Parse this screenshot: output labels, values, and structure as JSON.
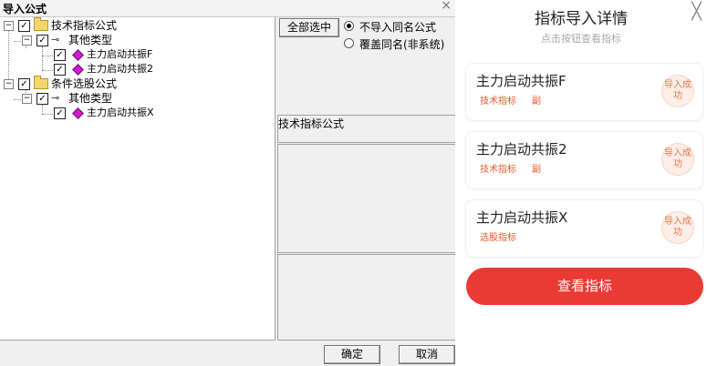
{
  "dialog": {
    "title": "导入公式",
    "tree": {
      "root1": "技术指标公式",
      "root1_child": "其他类型",
      "root1_items": [
        "主力启动共振F",
        "主力启动共振2"
      ],
      "root2": "条件选股公式",
      "root2_child": "其他类型",
      "root2_items": [
        "主力启动共振X"
      ]
    },
    "select_all": "全部选中",
    "options": [
      "不导入同名公式",
      "覆盖同名(非系统)"
    ],
    "selected_option": "不导入同名公式",
    "category_label": "技术指标公式",
    "ok": "确定",
    "cancel": "取消",
    "close_glyph": "×"
  },
  "modal": {
    "title": "指标导入详情",
    "subtitle": "点击按钮查看指标",
    "close_glyph": "╳",
    "items": [
      {
        "name": "主力启动共振F",
        "tag": "技术指标",
        "tag2": "副",
        "status": "导入成功"
      },
      {
        "name": "主力启动共振2",
        "tag": "技术指标",
        "tag2": "副",
        "status": "导入成功"
      },
      {
        "name": "主力启动共振X",
        "tag": "选股指标",
        "tag2": "",
        "status": "导入成功"
      }
    ],
    "view_button": "查看指标"
  }
}
